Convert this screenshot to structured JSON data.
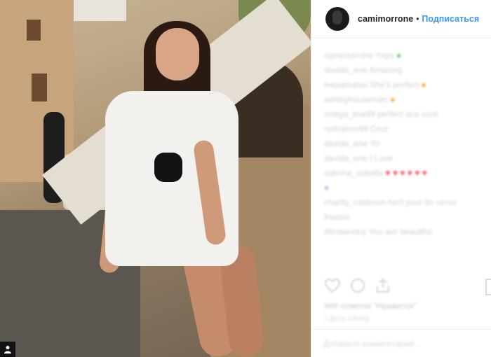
{
  "post": {
    "username": "camimorrone",
    "separator": "•",
    "follow_label": "Подписаться"
  },
  "comments": [
    {
      "text": "camimorrone Yaya",
      "emoji": "green"
    },
    {
      "text": "davida_ene Amazing",
      "emoji": ""
    },
    {
      "text": "leepamatas She's perfect",
      "emoji": "orange"
    },
    {
      "text": "ashleyhouseman",
      "emoji": "orange"
    },
    {
      "text": "ortega_lina99 perfect ana cool",
      "emoji": ""
    },
    {
      "text": "notnanos99 Cruz",
      "emoji": ""
    },
    {
      "text": "davida_ene Yo",
      "emoji": ""
    },
    {
      "text": "davida_ene I Love",
      "emoji": ""
    },
    {
      "text": "sabrina_sabella",
      "emoji": "red"
    },
    {
      "text": "",
      "emoji": "blue"
    },
    {
      "text": "charity_calderon Isn't your do verse",
      "emoji": ""
    },
    {
      "text": "freezer",
      "emoji": ""
    },
    {
      "text": "ifilmdareloy You are beautiful",
      "emoji": ""
    }
  ],
  "actions": {
    "like_icon": "heart-icon",
    "comment_icon": "comment-icon",
    "share_icon": "share-icon",
    "save_icon": "bookmark-icon"
  },
  "likes_text": "### отметок \"Нравится\"",
  "date_text": "1 ДЕНЬ НАЗАД",
  "comment_placeholder": "Добавьте комментарий...",
  "colors": {
    "link_blue": "#3897f0",
    "text_dark": "#262626",
    "border": "#efefef"
  }
}
